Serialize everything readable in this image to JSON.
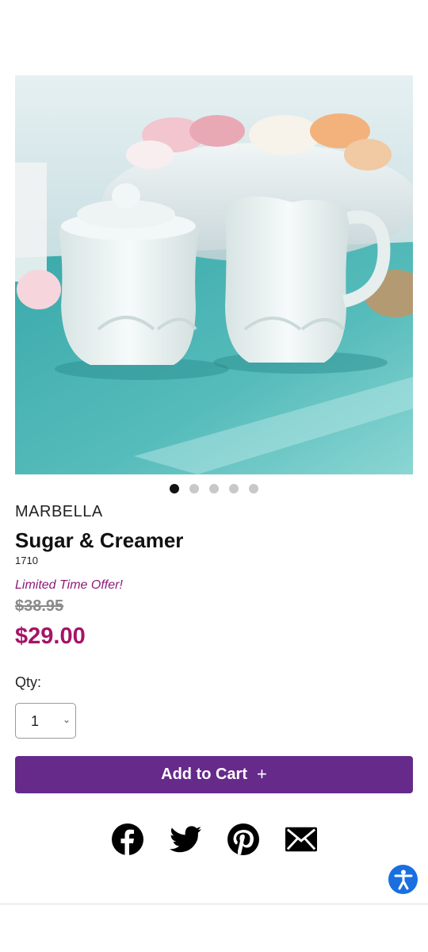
{
  "gallery": {
    "image_alt": "White ceramic sugar bowl with lid and creamer on a teal tablecloth",
    "slides": 5,
    "active_slide": 1
  },
  "product": {
    "brand": "MARBELLA",
    "title": "Sugar & Creamer",
    "sku": "1710",
    "offer_text": "Limited Time Offer!",
    "original_price": "$38.95",
    "sale_price": "$29.00"
  },
  "purchase": {
    "qty_label": "Qty:",
    "qty_value": "1",
    "add_to_cart_label": "Add to Cart",
    "add_to_cart_icon": "plus-icon"
  },
  "share": [
    "facebook-icon",
    "twitter-icon",
    "pinterest-icon",
    "email-icon"
  ],
  "colors": {
    "brand_purple": "#662a8a",
    "sale_price": "#a51466",
    "offer_text": "#8e1a78",
    "accessibility_blue": "#1a6fe0"
  }
}
